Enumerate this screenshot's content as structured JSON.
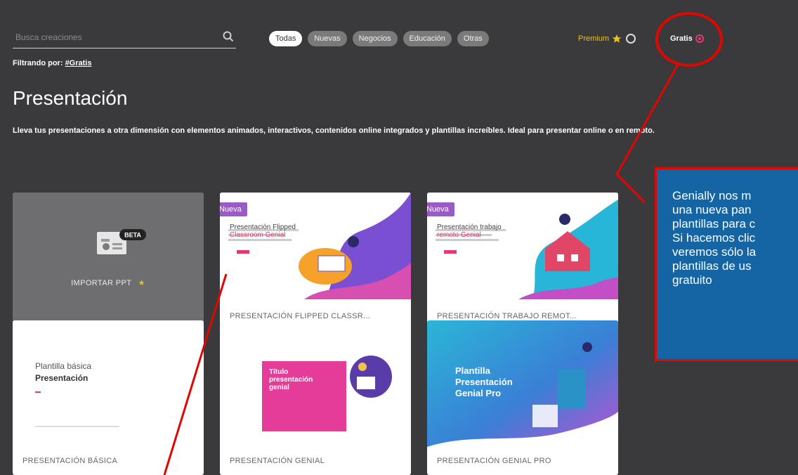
{
  "search": {
    "placeholder": "Busca creaciones",
    "icon": "search-icon"
  },
  "filters": [
    "Todas",
    "Nuevas",
    "Negocios",
    "Educación",
    "Otras"
  ],
  "premium_label": "Premium",
  "gratis_label": "Gratis",
  "filter_line": {
    "prefix": "Filtrando por:",
    "tag": "#Gratis"
  },
  "page_title": "Presentación",
  "description": "Lleva tus presentaciones a otra dimensión con elementos animados, interactivos, contenidos online integrados y plantillas increíbles. Ideal para presentar online o en remoto.",
  "cards": {
    "import": {
      "label": "IMPORTAR PPT",
      "badge": "BETA"
    },
    "flipped": {
      "badge": "Nueva",
      "thumb_title_1": "Presentación Flipped",
      "thumb_title_2": "Classroom Genial",
      "label": "PRESENTACIÓN FLIPPED CLASSR..."
    },
    "remoto": {
      "badge": "Nueva",
      "thumb_title_1": "Presentación trabajo",
      "thumb_title_2": "remoto Genial",
      "label": "PRESENTACIÓN TRABAJO REMOT..."
    },
    "basica": {
      "thumb_title_1": "Plantilla básica",
      "thumb_title_2": "Presentación",
      "label": "PRESENTACIÓN BÁSICA"
    },
    "genial": {
      "thumb_title": "Título presentación genial",
      "label": "PRESENTACIÓN GENIAL"
    },
    "pro": {
      "thumb_title": "Plantilla Presentación Genial Pro",
      "label": "PRESENTACIÓN GENIAL PRO"
    }
  },
  "callout_lines": [
    "Genially nos m",
    "una nueva pan",
    "plantillas para c",
    "Si hacemos clic",
    "veremos sólo la",
    "plantillas de us",
    "gratuito"
  ],
  "colors": {
    "background": "#3a3a3c",
    "accent_red": "#e10600",
    "callout_blue": "#1565a4",
    "new_badge": "#9b5bc6",
    "premium": "#e8c21f"
  }
}
